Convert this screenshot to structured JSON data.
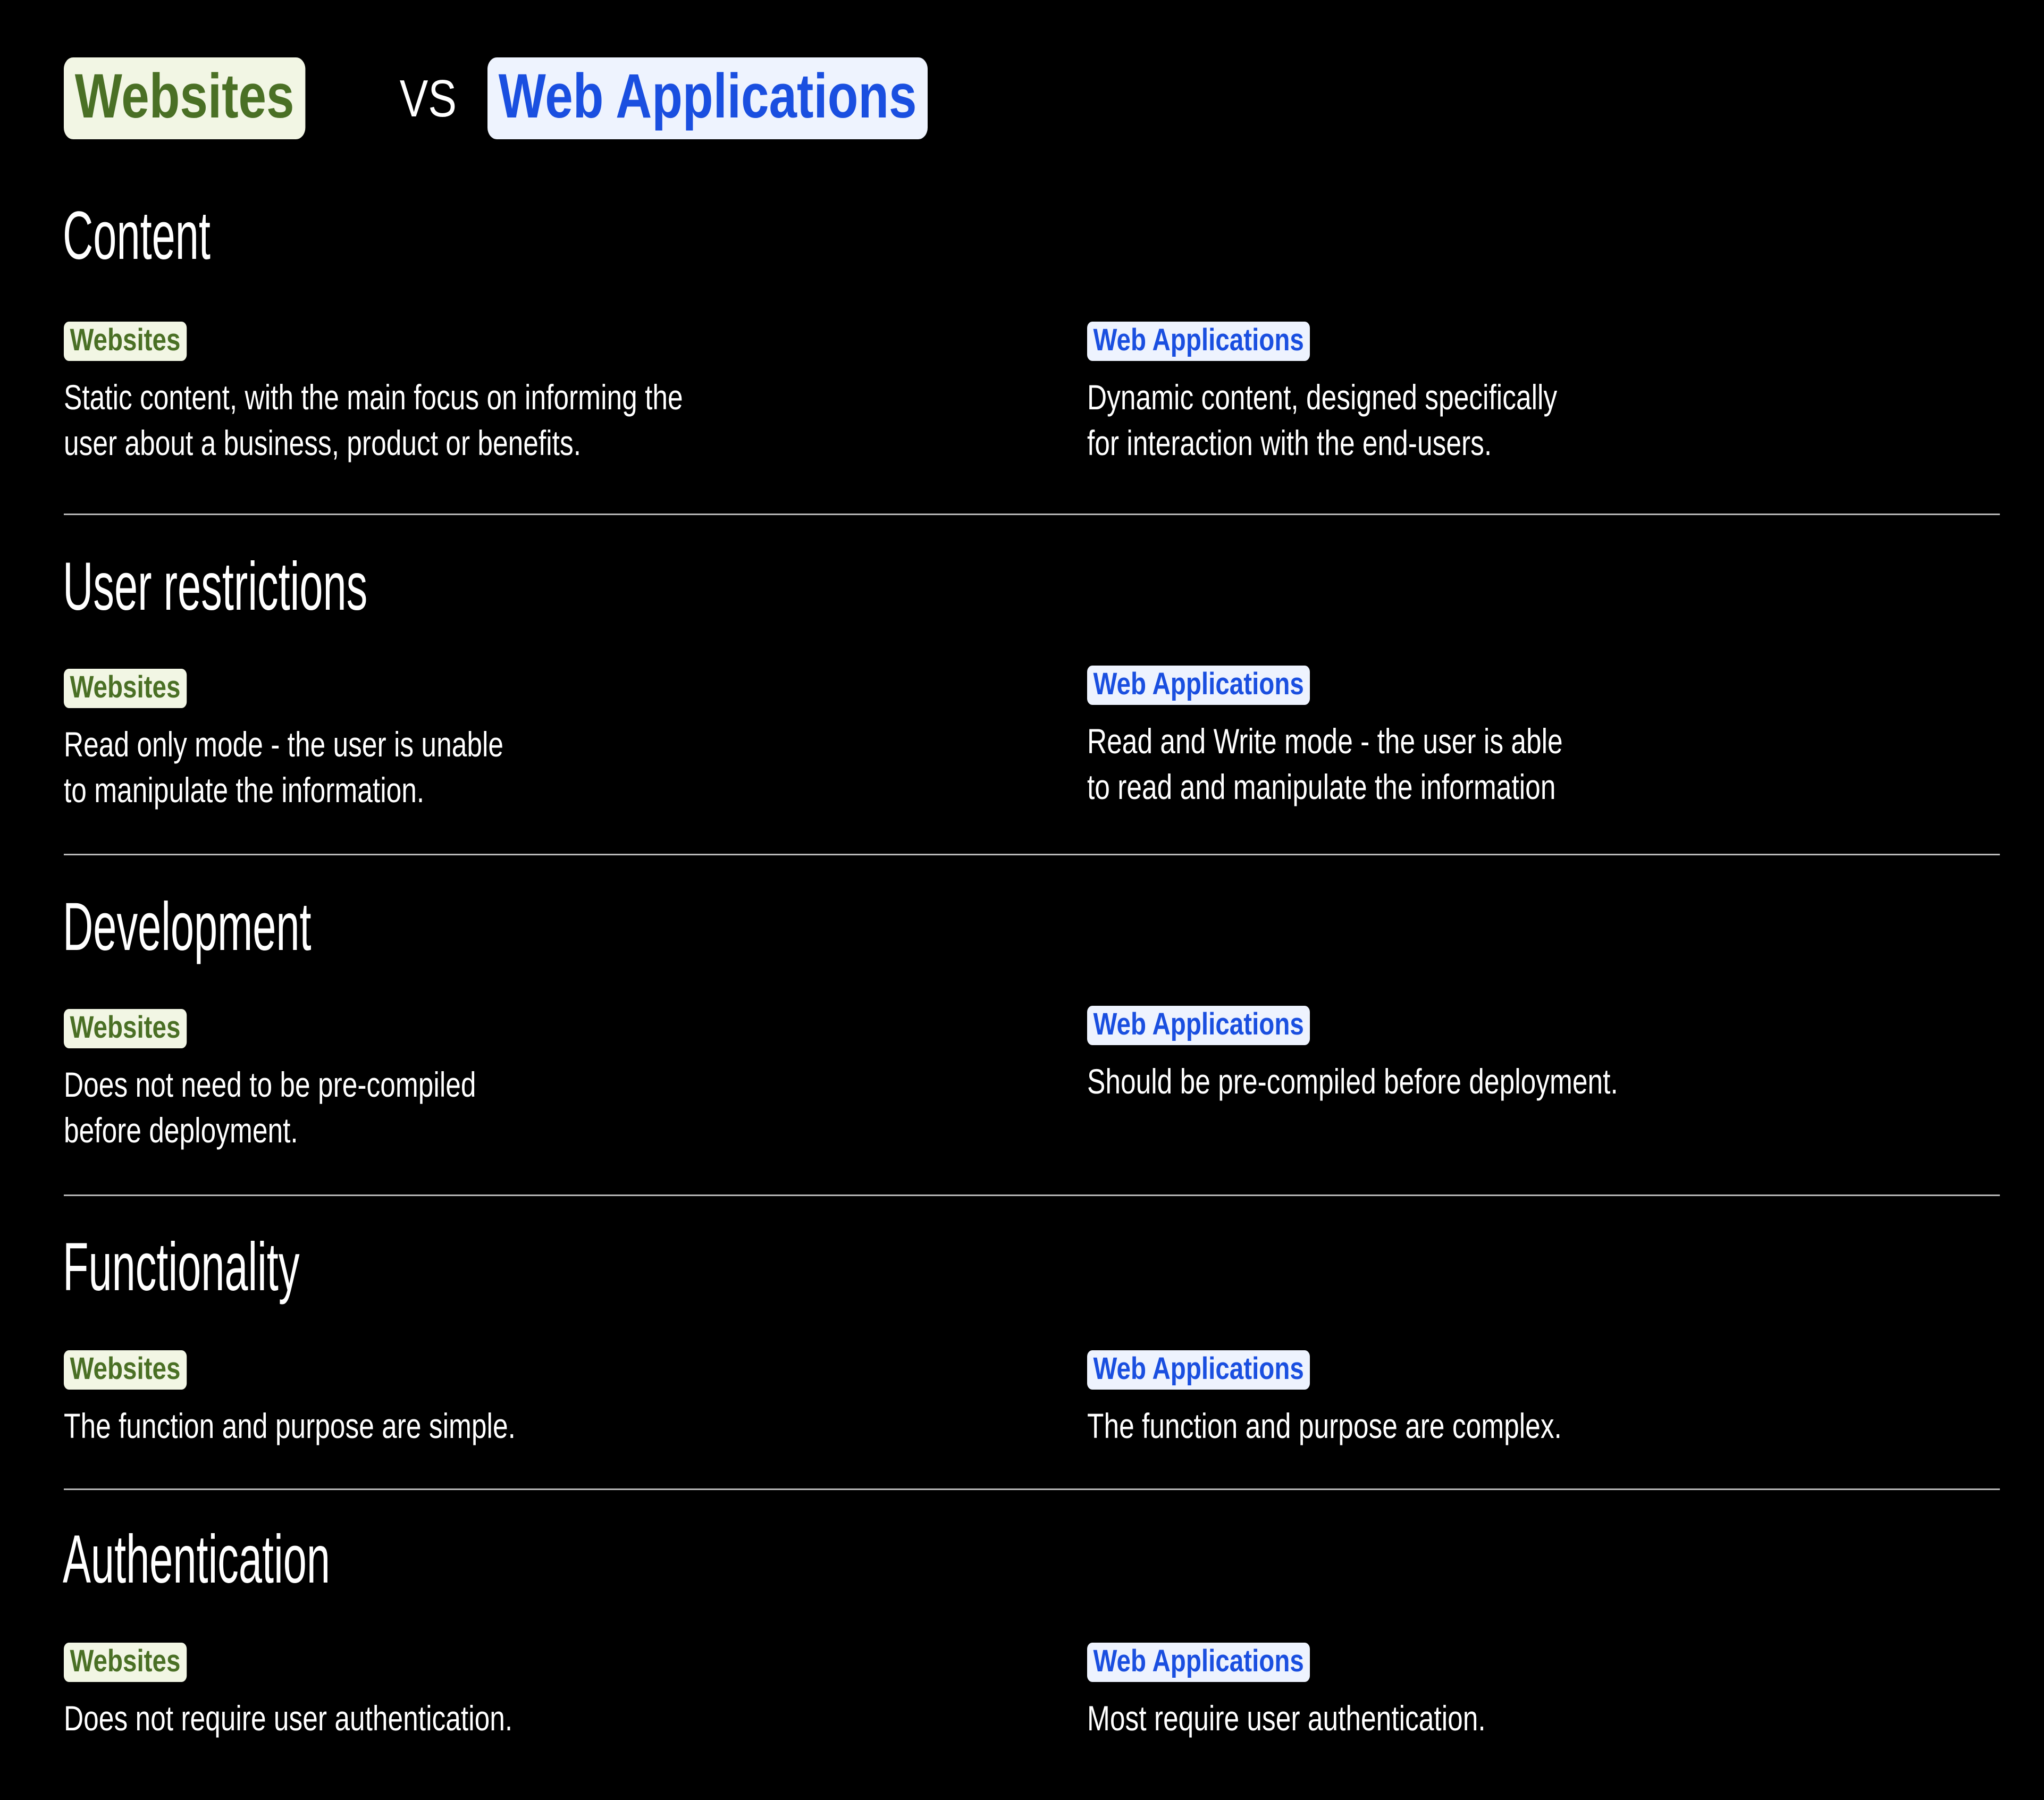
{
  "page": {
    "background_color": "#000000",
    "text_color": "#ffffff",
    "divider_color": "#b9b9b9"
  },
  "title": {
    "left_badge": "Websites",
    "separator": "VS",
    "right_badge": "Web Applications",
    "left_badge_bg": "#f2f6e4",
    "left_badge_fg": "#4a7025",
    "right_badge_bg": "#eef3fe",
    "right_badge_fg": "#1a4fe0"
  },
  "labels": {
    "websites": "Websites",
    "web_applications": "Web Applications"
  },
  "sections": [
    {
      "heading": "Content",
      "left": {
        "tag": "Websites",
        "text": "Static content, with the main focus on informing the\nuser about a business, product or benefits."
      },
      "right": {
        "tag": "Web Applications",
        "text": "Dynamic content, designed specifically\nfor interaction with the end-users."
      }
    },
    {
      "heading": "User restrictions",
      "left": {
        "tag": "Websites",
        "text": "Read only mode - the user is unable\nto manipulate the information."
      },
      "right": {
        "tag": "Web Applications",
        "text": "Read and Write mode - the user is able\nto read and manipulate the information"
      }
    },
    {
      "heading": "Development",
      "left": {
        "tag": "Websites",
        "text": "Does not need to be pre-compiled\nbefore deployment."
      },
      "right": {
        "tag": "Web Applications",
        "text": "Should be pre-compiled before deployment."
      }
    },
    {
      "heading": "Functionality",
      "left": {
        "tag": "Websites",
        "text": "The function and purpose are simple."
      },
      "right": {
        "tag": "Web Applications",
        "text": "The function and purpose are complex."
      }
    },
    {
      "heading": "Authentication",
      "left": {
        "tag": "Websites",
        "text": "Does not require user authentication."
      },
      "right": {
        "tag": "Web Applications",
        "text": "Most require user authentication."
      }
    }
  ]
}
